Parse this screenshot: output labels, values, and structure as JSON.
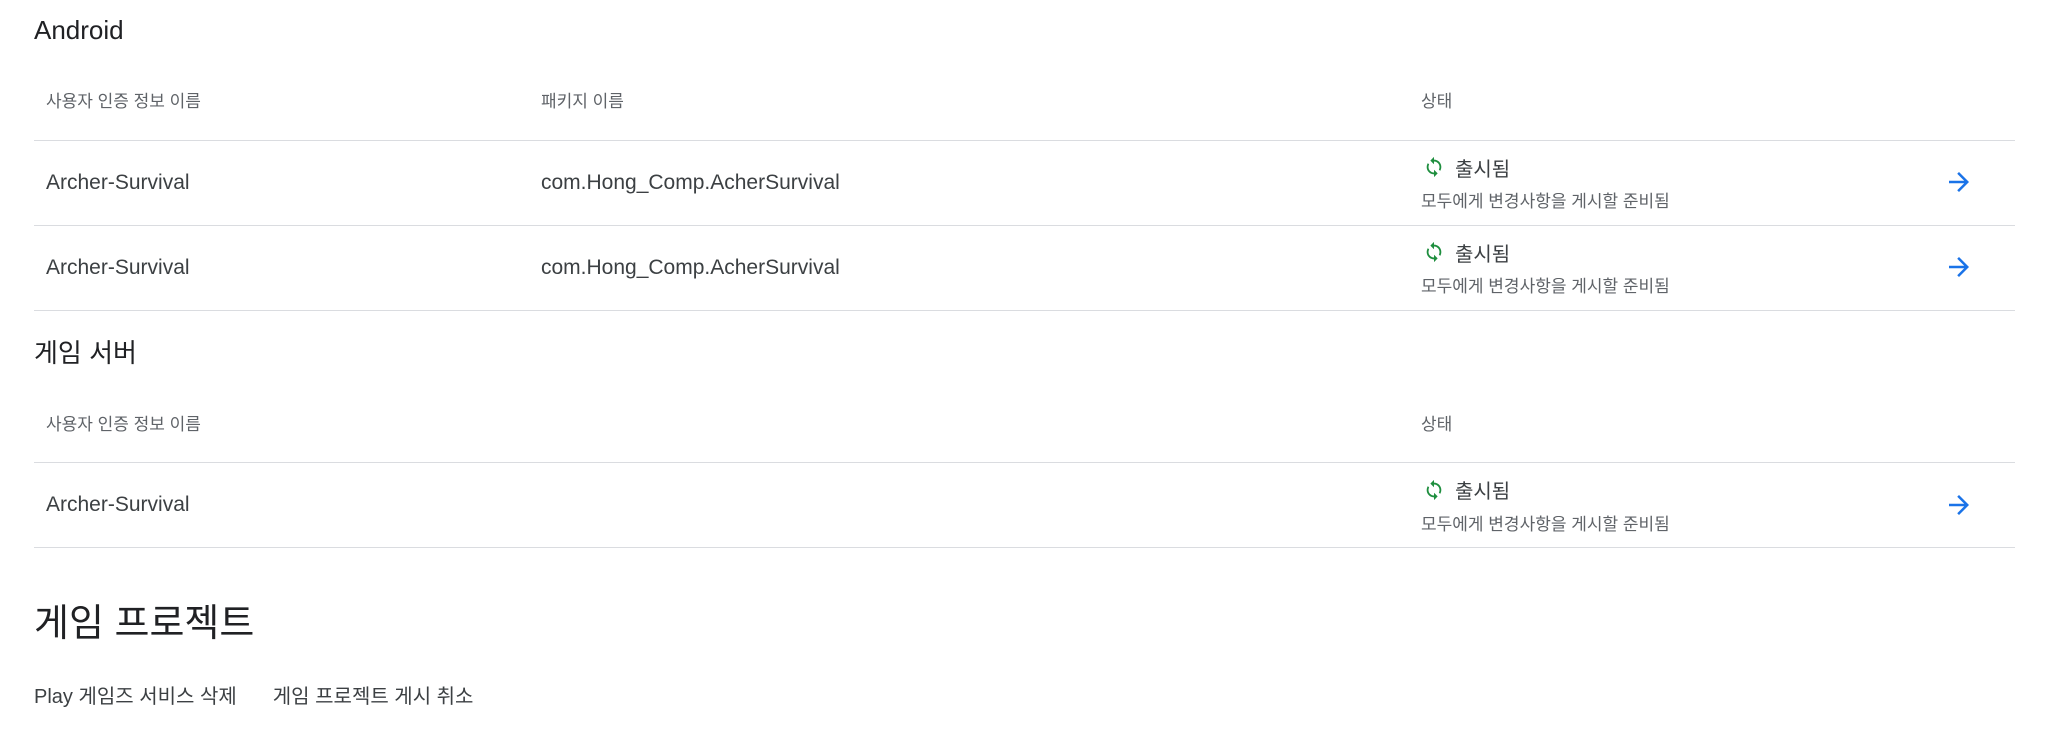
{
  "android": {
    "title": "Android",
    "headers": {
      "credential_name": "사용자 인증 정보 이름",
      "package_name": "패키지 이름",
      "status": "상태"
    },
    "rows": [
      {
        "credential_name": "Archer-Survival",
        "package_name": "com.Hong_Comp.AcherSurvival",
        "status": "출시됨",
        "status_detail": "모두에게 변경사항을 게시할 준비됨"
      },
      {
        "credential_name": "Archer-Survival",
        "package_name": "com.Hong_Comp.AcherSurvival",
        "status": "출시됨",
        "status_detail": "모두에게 변경사항을 게시할 준비됨"
      }
    ]
  },
  "game_server": {
    "title": "게임 서버",
    "headers": {
      "credential_name": "사용자 인증 정보 이름",
      "status": "상태"
    },
    "rows": [
      {
        "credential_name": "Archer-Survival",
        "status": "출시됨",
        "status_detail": "모두에게 변경사항을 게시할 준비됨"
      }
    ]
  },
  "project": {
    "title": "게임 프로젝트",
    "actions": {
      "delete_label": "Play 게임즈 서비스 삭제",
      "unpublish_label": "게임 프로젝트 게시 취소"
    }
  },
  "colors": {
    "status_icon": "#1e8e3e",
    "arrow": "#1a73e8"
  },
  "icons": {
    "status": "sync-icon",
    "row_action": "arrow-forward-icon"
  }
}
